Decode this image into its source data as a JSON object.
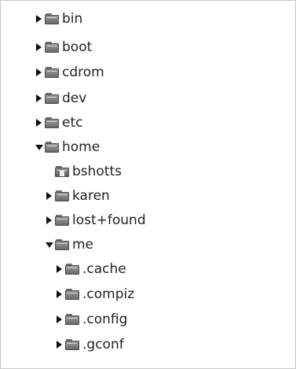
{
  "tree": {
    "items": [
      {
        "label": "bin",
        "depth": 0,
        "expander": "collapsed",
        "icon": "folder-icon"
      },
      {
        "label": "boot",
        "depth": 0,
        "expander": "collapsed",
        "icon": "folder-icon"
      },
      {
        "label": "cdrom",
        "depth": 0,
        "expander": "collapsed",
        "icon": "folder-icon"
      },
      {
        "label": "dev",
        "depth": 0,
        "expander": "collapsed",
        "icon": "folder-icon"
      },
      {
        "label": "etc",
        "depth": 0,
        "expander": "collapsed",
        "icon": "folder-icon"
      },
      {
        "label": "home",
        "depth": 0,
        "expander": "expanded",
        "icon": "folder-icon"
      },
      {
        "label": "bshotts",
        "depth": 1,
        "expander": "none",
        "icon": "home-folder-icon"
      },
      {
        "label": "karen",
        "depth": 1,
        "expander": "collapsed",
        "icon": "folder-icon"
      },
      {
        "label": "lost+found",
        "depth": 1,
        "expander": "collapsed",
        "icon": "folder-icon"
      },
      {
        "label": "me",
        "depth": 1,
        "expander": "expanded",
        "icon": "folder-icon"
      },
      {
        "label": ".cache",
        "depth": 2,
        "expander": "collapsed",
        "icon": "folder-icon"
      },
      {
        "label": ".compiz",
        "depth": 2,
        "expander": "collapsed",
        "icon": "folder-icon"
      },
      {
        "label": ".config",
        "depth": 2,
        "expander": "collapsed",
        "icon": "folder-icon"
      },
      {
        "label": ".gconf",
        "depth": 2,
        "expander": "collapsed",
        "icon": "folder-icon"
      }
    ]
  }
}
